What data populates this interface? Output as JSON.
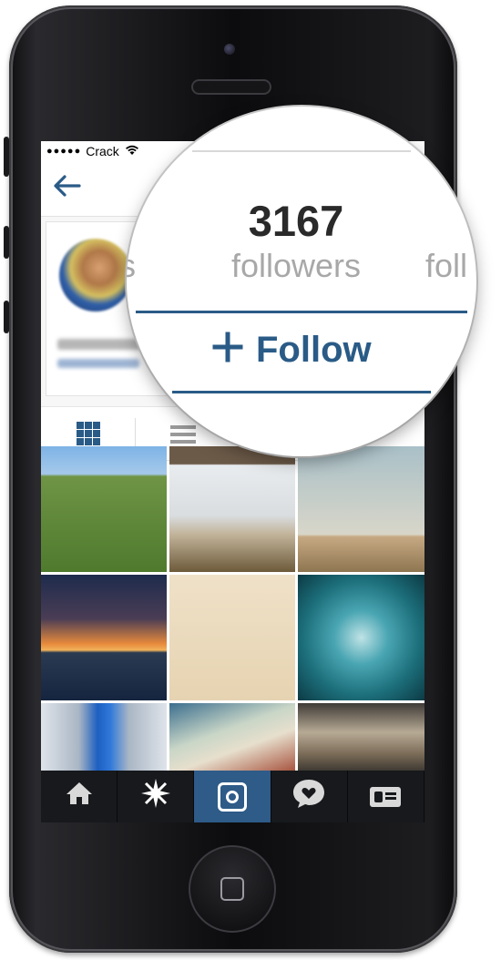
{
  "status_bar": {
    "signal": "●●●●●",
    "carrier": "Crack",
    "wifi_icon": "wifi-icon"
  },
  "profile": {
    "followers_count": "3167",
    "followers_label": "followers",
    "left_partial_label": "s",
    "right_partial_label": "foll",
    "follow_button": "+ Follow",
    "follow_label": "Follow"
  },
  "tab_bar": {
    "items": [
      {
        "icon": "home-icon",
        "active": false
      },
      {
        "icon": "explore-icon",
        "active": false
      },
      {
        "icon": "camera-icon",
        "active": true
      },
      {
        "icon": "news-icon",
        "active": false
      },
      {
        "icon": "profile-icon",
        "active": false
      }
    ]
  },
  "colors": {
    "accent": "#2a5b87",
    "tab_bar": "#17191c",
    "active_tab": "#2e5b88"
  }
}
